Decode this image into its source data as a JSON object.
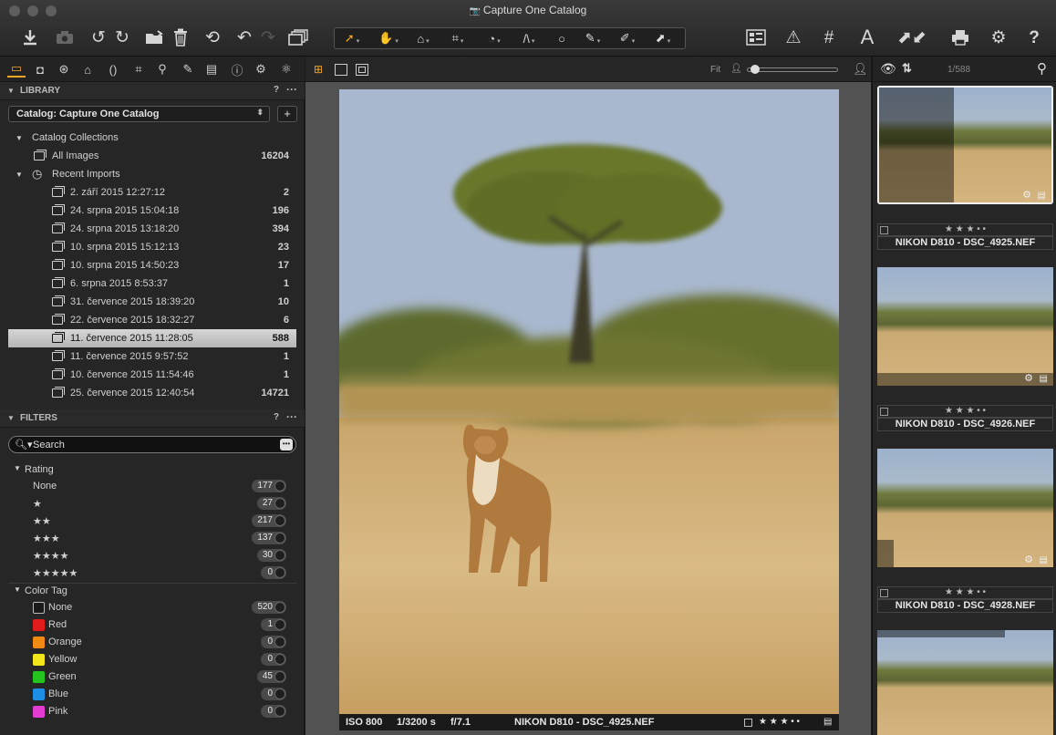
{
  "window": {
    "title": "Capture One Catalog"
  },
  "toolbar": {
    "icons": [
      "import-icon",
      "camera-icon",
      "rotate-left-icon",
      "rotate-right-icon",
      "move-to-folder-icon",
      "trash-icon",
      "undo-icon",
      "back-icon",
      "forward-icon",
      "clone-variant-icon",
      "select-cursor-icon",
      "pan-hand-icon",
      "loupe-icon",
      "crop-icon",
      "rotate-straighten-icon",
      "keystone-icon",
      "spot-removal-icon",
      "brush-icon",
      "color-picker-icon",
      "copy-apply-icon",
      "grid-view-icon",
      "exposure-warning-icon",
      "grid-overlay-icon",
      "text-overlay-icon",
      "copy-adjustments-icon",
      "print-icon",
      "settings-icon",
      "help-icon"
    ],
    "help_label": "?"
  },
  "library": {
    "header": "LIBRARY",
    "help": "?",
    "menu": "···",
    "catalog_select": "Catalog: Capture One Catalog",
    "add_label": "+",
    "catalog_collections": "Catalog Collections",
    "all_images": {
      "label": "All Images",
      "count": "16204"
    },
    "recent_imports": "Recent Imports",
    "imports": [
      {
        "label": "2. září 2015 12:27:12",
        "count": "2"
      },
      {
        "label": "24. srpna 2015 15:04:18",
        "count": "196"
      },
      {
        "label": "24. srpna 2015 13:18:20",
        "count": "394"
      },
      {
        "label": "10. srpna 2015 15:12:13",
        "count": "23"
      },
      {
        "label": "10. srpna 2015 14:50:23",
        "count": "17"
      },
      {
        "label": "6. srpna 2015 8:53:37",
        "count": "1"
      },
      {
        "label": "31. července 2015 18:39:20",
        "count": "10"
      },
      {
        "label": "22. července 2015 18:32:27",
        "count": "6"
      },
      {
        "label": "11. července 2015 11:28:05",
        "count": "588"
      },
      {
        "label": "11. července 2015 9:57:52",
        "count": "1"
      },
      {
        "label": "10. července 2015 11:54:46",
        "count": "1"
      },
      {
        "label": "25. července 2015 12:40:54",
        "count": "14721"
      }
    ],
    "selected_index": 8
  },
  "filters": {
    "header": "FILTERS",
    "help": "?",
    "menu": "···",
    "search_placeholder": "Search",
    "rating_title": "Rating",
    "ratings": [
      {
        "label": "None",
        "count": "177"
      },
      {
        "label": "★",
        "count": "27"
      },
      {
        "label": "★★",
        "count": "217"
      },
      {
        "label": "★★★",
        "count": "137"
      },
      {
        "label": "★★★★",
        "count": "30"
      },
      {
        "label": "★★★★★",
        "count": "0"
      }
    ],
    "color_tag_title": "Color Tag",
    "color_tags": [
      {
        "label": "None",
        "count": "520",
        "color": "#1a1a1a"
      },
      {
        "label": "Red",
        "count": "1",
        "color": "#e21b1b"
      },
      {
        "label": "Orange",
        "count": "0",
        "color": "#f08a12"
      },
      {
        "label": "Yellow",
        "count": "0",
        "color": "#f2e51a"
      },
      {
        "label": "Green",
        "count": "45",
        "color": "#23c41e"
      },
      {
        "label": "Blue",
        "count": "0",
        "color": "#1e8fe6"
      },
      {
        "label": "Pink",
        "count": "0",
        "color": "#e23cd2"
      }
    ]
  },
  "viewer": {
    "zoom_label": "Fit",
    "caption": {
      "iso": "ISO 800",
      "shutter": "1/3200 s",
      "aperture": "f/7.1",
      "name": "NIKON D810 - DSC_4925.NEF",
      "stars": "★ ★ ★ • •"
    }
  },
  "browser": {
    "count": "1/588",
    "thumbs": [
      {
        "stars": "★ ★ ★ • •",
        "name": "NIKON D810 - DSC_4925.NEF"
      },
      {
        "stars": "★ ★ ★ • •",
        "name": "NIKON D810 - DSC_4926.NEF"
      },
      {
        "stars": "★ ★ ★ • •",
        "name": "NIKON D810 - DSC_4928.NEF"
      }
    ]
  },
  "colors": {
    "accent": "#f5a623",
    "selected_row": "#c8c8c8"
  }
}
